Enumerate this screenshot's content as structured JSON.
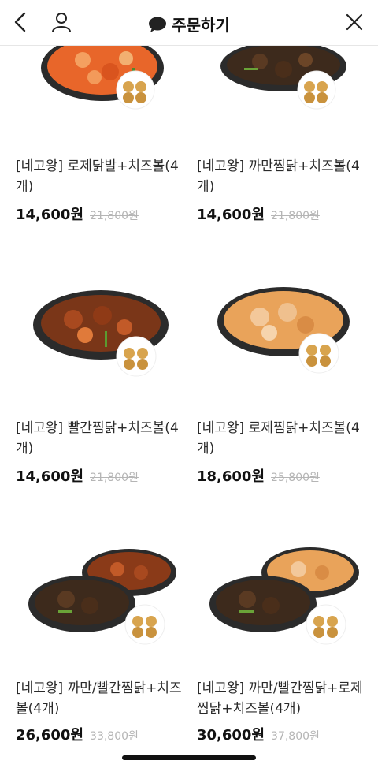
{
  "header": {
    "title": "주문하기",
    "back_icon": "chevron-left-icon",
    "user_icon": "user-icon",
    "title_icon": "chat-bubble-icon",
    "close_icon": "close-icon"
  },
  "products": [
    {
      "name": "[네고왕] 로제닭발+치즈볼(4개)",
      "price": "14,600원",
      "original_price": "21,800원"
    },
    {
      "name": "[네고왕] 까만찜닭+치즈볼(4개)",
      "price": "14,600원",
      "original_price": "21,800원"
    },
    {
      "name": "[네고왕] 빨간찜닭+치즈볼(4개)",
      "price": "14,600원",
      "original_price": "21,800원"
    },
    {
      "name": "[네고왕] 로제찜닭+치즈볼(4개)",
      "price": "18,600원",
      "original_price": "25,800원"
    },
    {
      "name": "[네고왕] 까만/빨간찜닭+치즈볼(4개)",
      "price": "26,600원",
      "original_price": "33,800원"
    },
    {
      "name": "[네고왕] 까만/빨간찜닭+로제찜닭+치즈볼(4개)",
      "price": "30,600원",
      "original_price": "37,800원"
    }
  ]
}
